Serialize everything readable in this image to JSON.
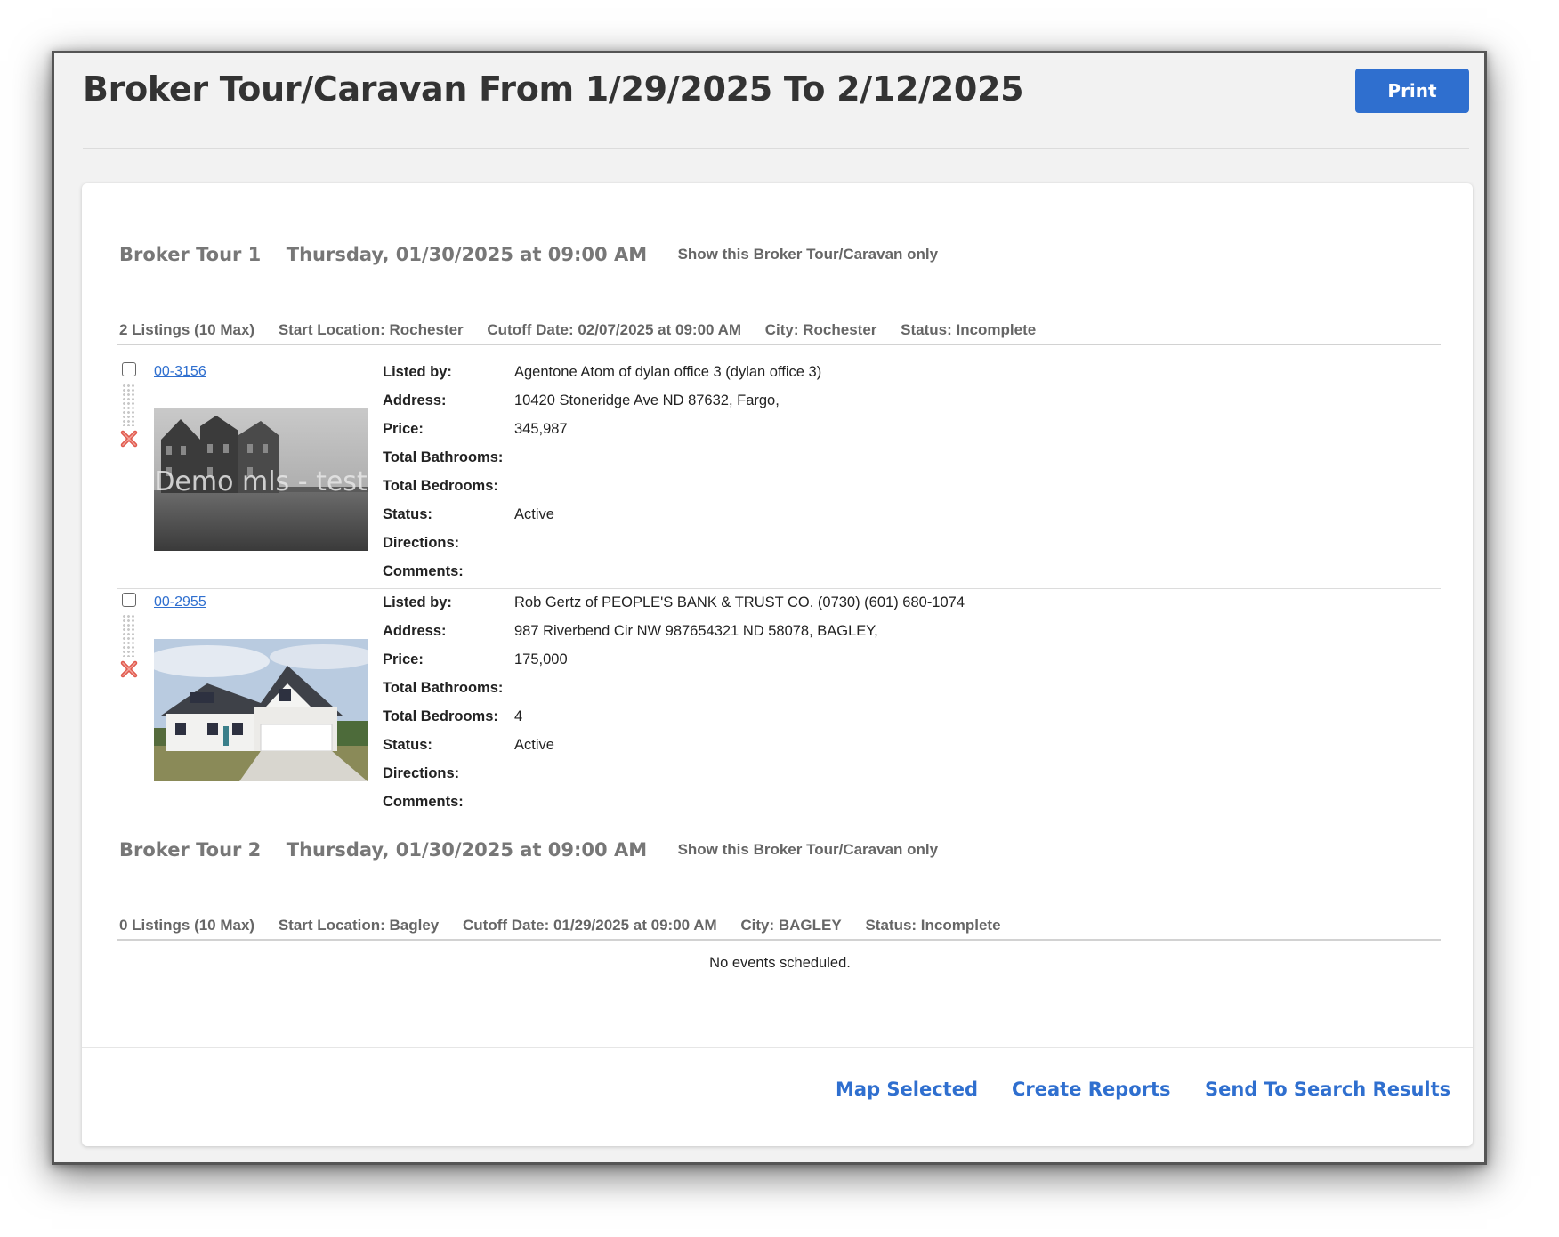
{
  "window": {
    "title": "Broker Tour/Caravan From 1/29/2025 To 2/12/2025",
    "print_label": "Print"
  },
  "tours": [
    {
      "name": "Broker Tour 1",
      "date": "Thursday, 01/30/2025 at 09:00 AM",
      "show_only_label": "Show this Broker Tour/Caravan only",
      "listings_count": "2 Listings (10 Max)",
      "start_location": "Start Location: Rochester",
      "cutoff": "Cutoff Date: 02/07/2025 at 09:00 AM",
      "city": "City: Rochester",
      "status": "Status: Incomplete",
      "listings": [
        {
          "mls": "00-3156",
          "photo_overlay": "Demo mls - test",
          "fields": [
            {
              "label": "Listed by:",
              "value": "Agentone Atom of dylan office 3 (dylan office 3)"
            },
            {
              "label": "Address:",
              "value": "10420 Stoneridge Ave ND 87632, Fargo,"
            },
            {
              "label": "Price:",
              "value": "345,987"
            },
            {
              "label": "Total Bathrooms:",
              "value": ""
            },
            {
              "label": "Total Bedrooms:",
              "value": ""
            },
            {
              "label": "Status:",
              "value": "Active"
            },
            {
              "label": "Directions:",
              "value": ""
            },
            {
              "label": "Comments:",
              "value": ""
            }
          ]
        },
        {
          "mls": "00-2955",
          "fields": [
            {
              "label": "Listed by:",
              "value": "Rob Gertz of PEOPLE'S BANK & TRUST CO. (0730) (601) 680-1074"
            },
            {
              "label": "Address:",
              "value": "987 Riverbend Cir NW 987654321 ND 58078, BAGLEY,"
            },
            {
              "label": "Price:",
              "value": "175,000"
            },
            {
              "label": "Total Bathrooms:",
              "value": ""
            },
            {
              "label": "Total Bedrooms:",
              "value": "4"
            },
            {
              "label": "Status:",
              "value": "Active"
            },
            {
              "label": "Directions:",
              "value": ""
            },
            {
              "label": "Comments:",
              "value": ""
            }
          ]
        }
      ]
    },
    {
      "name": "Broker Tour 2",
      "date": "Thursday, 01/30/2025 at 09:00 AM",
      "show_only_label": "Show this Broker Tour/Caravan only",
      "listings_count": "0 Listings (10 Max)",
      "start_location": "Start Location: Bagley",
      "cutoff": "Cutoff Date: 01/29/2025 at 09:00 AM",
      "city": "City: BAGLEY",
      "status": "Status: Incomplete",
      "empty_message": "No events scheduled."
    }
  ],
  "footer": {
    "map_selected": "Map Selected",
    "create_reports": "Create Reports",
    "send_to_search": "Send To Search Results"
  },
  "colors": {
    "accent": "#2f6fcf",
    "remove_icon": "#e05a4e"
  },
  "icons": {
    "remove": "remove-x-icon",
    "drag": "drag-handle-icon"
  }
}
